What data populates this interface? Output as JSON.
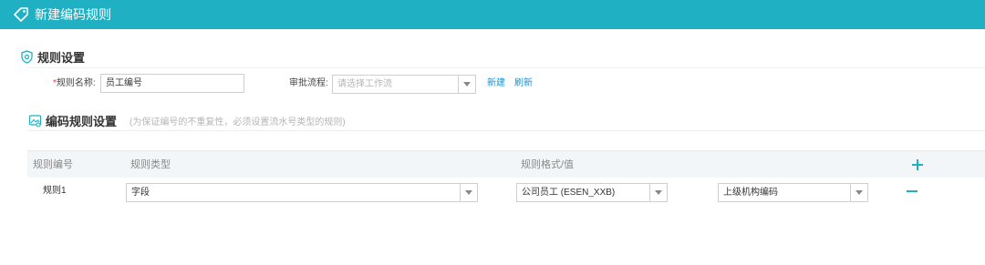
{
  "window": {
    "title": "新建编码规则",
    "icon": "tag-icon"
  },
  "colors": {
    "titlebar": "#1fb0c4",
    "accent": "#1fb0c4",
    "link": "#1a8fd1",
    "required": "#e03b3b"
  },
  "rule_settings": {
    "heading": "规则设置",
    "name_label_required": "*",
    "name_label": "规则名称:",
    "name_value": "员工编号",
    "flow_label": "审批流程:",
    "flow_placeholder": "请选择工作流",
    "new_link": "新建",
    "refresh_link": "刷新"
  },
  "code_rule_settings": {
    "heading": "编码规则设置",
    "note": "(为保证编号的不重复性，必须设置流水号类型的规则)",
    "columns": [
      "规则编号",
      "规则类型",
      "规则格式/值"
    ],
    "rows": [
      {
        "id": "规则1",
        "type": "字段",
        "format": "公司员工 (ESEN_XXB)",
        "value": "上级机构编码"
      }
    ]
  }
}
